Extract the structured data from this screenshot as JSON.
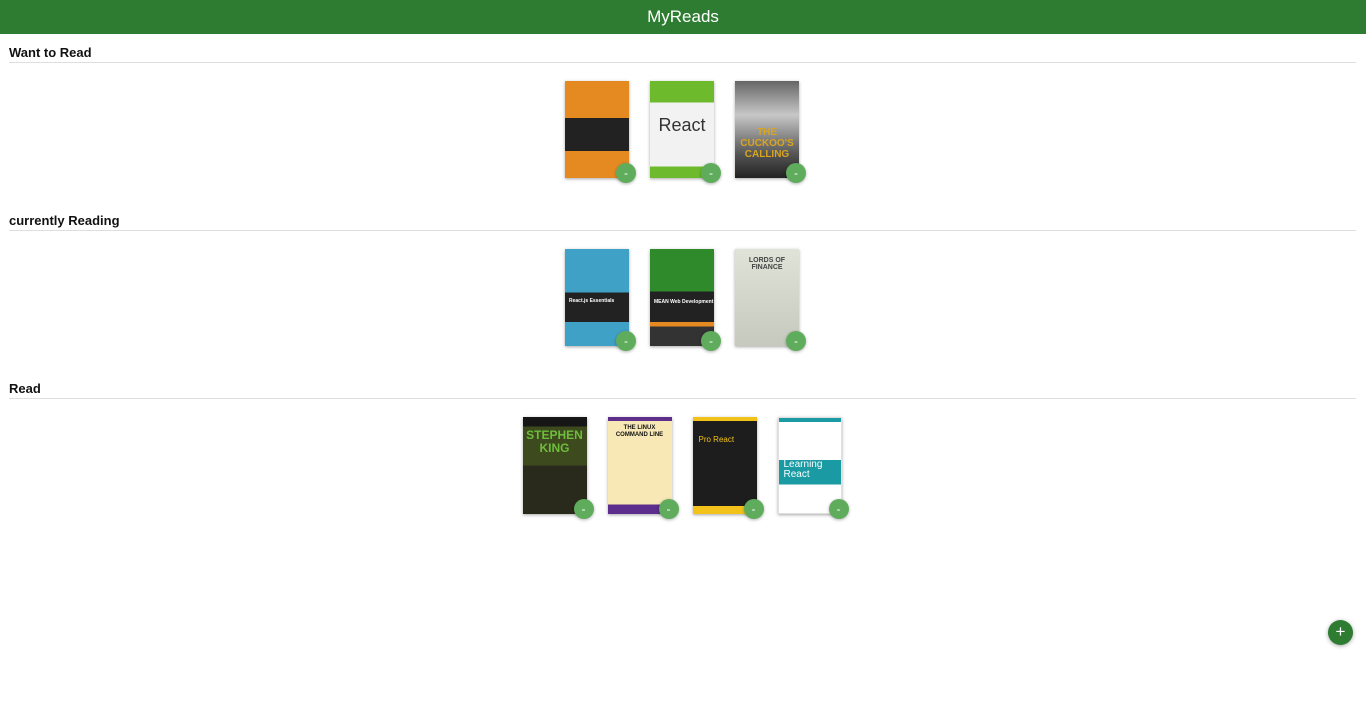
{
  "header": {
    "title": "MyReads"
  },
  "shelves": [
    {
      "title": "Want to Read",
      "books": [
        {
          "cover_text": "",
          "cover_style": "cv-orange",
          "changer_icon": "-"
        },
        {
          "cover_text": "React",
          "cover_style": "cv-react",
          "changer_icon": "-"
        },
        {
          "cover_text": "THE CUCKOO'S CALLING",
          "cover_style": "cv-cuckoo",
          "changer_icon": "-"
        }
      ]
    },
    {
      "title": "currently Reading",
      "books": [
        {
          "cover_text": "React.js Essentials",
          "cover_style": "cv-sky",
          "changer_icon": "-"
        },
        {
          "cover_text": "MEAN Web Development",
          "cover_style": "cv-mean",
          "changer_icon": "-"
        },
        {
          "cover_text": "LORDS OF FINANCE",
          "cover_style": "cv-lords",
          "changer_icon": "-"
        }
      ]
    },
    {
      "title": "Read",
      "books": [
        {
          "cover_text": "STEPHEN KING",
          "cover_style": "cv-king",
          "changer_icon": "-"
        },
        {
          "cover_text": "THE LINUX COMMAND LINE",
          "cover_style": "cv-linux",
          "changer_icon": "-"
        },
        {
          "cover_text": "Pro React",
          "cover_style": "cv-pro",
          "changer_icon": "-"
        },
        {
          "cover_text": "Learning React",
          "cover_style": "cv-learning",
          "changer_icon": "-"
        }
      ]
    }
  ],
  "add_button": {
    "icon": "+"
  },
  "colors": {
    "header": "#2e7c31",
    "changer": "#60ac5d",
    "add_button": "#2e7c31"
  }
}
